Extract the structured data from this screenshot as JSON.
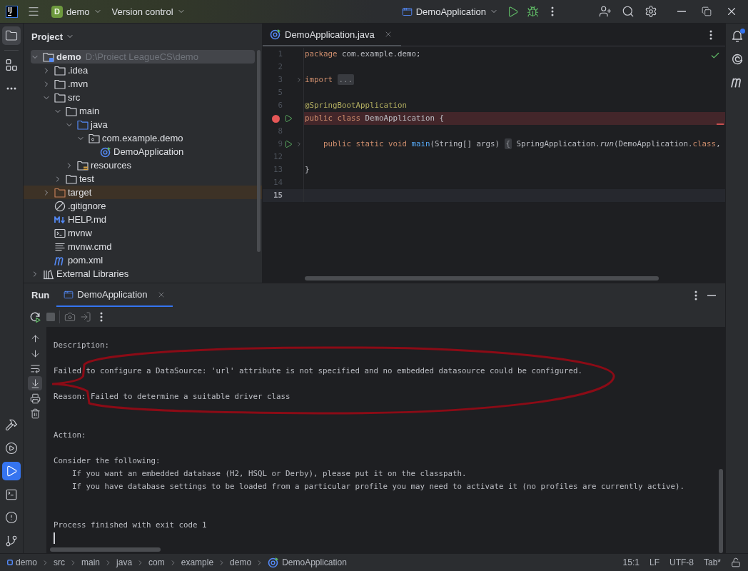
{
  "title_bar": {
    "logo": "IJ",
    "project_badge": "D",
    "project_name": "demo",
    "vcs_menu": "Version control",
    "run_configuration": "DemoApplication"
  },
  "left_toolbar": {
    "top": [
      {
        "kind": "project",
        "selected": true,
        "focused": false
      },
      {
        "kind": "structure",
        "selected": false,
        "focused": false
      },
      {
        "kind": "more",
        "selected": false,
        "focused": false
      }
    ],
    "bottom": [
      {
        "kind": "build",
        "selected": false,
        "focused": false
      },
      {
        "kind": "services",
        "selected": false,
        "focused": false
      },
      {
        "kind": "run",
        "selected": true,
        "focused": true
      },
      {
        "kind": "terminal",
        "selected": false,
        "focused": false
      },
      {
        "kind": "problems",
        "selected": false,
        "focused": false
      },
      {
        "kind": "git",
        "selected": false,
        "focused": false
      }
    ]
  },
  "project_panel": {
    "title": "Project",
    "tree": [
      {
        "label": "demo",
        "path": "D:\\Proiect LeagueCS\\demo",
        "kind": "module",
        "expanded": true,
        "selected": true,
        "children": [
          {
            "label": ".idea",
            "kind": "folder",
            "expanded": false,
            "selected": false
          },
          {
            "label": ".mvn",
            "kind": "folder",
            "expanded": false,
            "selected": false
          },
          {
            "label": "src",
            "kind": "folder",
            "expanded": true,
            "selected": false,
            "children": [
              {
                "label": "main",
                "kind": "folder",
                "expanded": true,
                "selected": false,
                "children": [
                  {
                    "label": "java",
                    "kind": "source-root",
                    "expanded": true,
                    "selected": false,
                    "children": [
                      {
                        "label": "com.example.demo",
                        "kind": "package",
                        "expanded": true,
                        "selected": false,
                        "children": [
                          {
                            "label": "DemoApplication",
                            "kind": "spring-class",
                            "selected": false
                          }
                        ]
                      }
                    ]
                  },
                  {
                    "label": "resources",
                    "kind": "resources-root",
                    "expanded": false,
                    "selected": false
                  }
                ]
              },
              {
                "label": "test",
                "kind": "folder",
                "expanded": false,
                "selected": false
              }
            ]
          },
          {
            "label": "target",
            "kind": "excluded-folder",
            "expanded": false,
            "selected": false
          },
          {
            "label": ".gitignore",
            "kind": "ignore-file",
            "selected": false
          },
          {
            "label": "HELP.md",
            "kind": "markdown-file",
            "selected": false
          },
          {
            "label": "mvnw",
            "kind": "script-file",
            "selected": false
          },
          {
            "label": "mvnw.cmd",
            "kind": "text-file",
            "selected": false
          },
          {
            "label": "pom.xml",
            "kind": "maven-file",
            "selected": false
          }
        ]
      },
      {
        "label": "External Libraries",
        "kind": "libraries",
        "expanded": false,
        "selected": false
      }
    ]
  },
  "editor": {
    "tabs": [
      {
        "label": "DemoApplication.java",
        "kind": "spring-class",
        "selected": true
      }
    ],
    "inspection_ok": true,
    "lines": [
      {
        "number": "1",
        "tokens": [
          {
            "text": "package",
            "kind": "keyword"
          },
          {
            "text": " com.example.demo;",
            "kind": "plain"
          }
        ],
        "breakpoint": false,
        "run_icon": false,
        "folded": false,
        "error": false,
        "current": false
      },
      {
        "number": "2",
        "breakpoint": false,
        "run_icon": false,
        "folded": false,
        "error": false,
        "current": false
      },
      {
        "number": "3",
        "tokens": [
          {
            "text": "import ",
            "kind": "keyword"
          },
          {
            "text": "...",
            "kind": "folded"
          }
        ],
        "breakpoint": false,
        "run_icon": false,
        "folded": true,
        "error": false,
        "current": false
      },
      {
        "number": "5",
        "breakpoint": false,
        "run_icon": false,
        "folded": false,
        "error": false,
        "current": false
      },
      {
        "number": "6",
        "tokens": [
          {
            "text": "@SpringBootApplication",
            "kind": "annotation"
          }
        ],
        "breakpoint": false,
        "run_icon": false,
        "folded": false,
        "error": false,
        "current": false
      },
      {
        "tokens": [
          {
            "text": "public class ",
            "kind": "keyword"
          },
          {
            "text": "DemoApplication {",
            "kind": "plain"
          }
        ],
        "breakpoint": true,
        "run_icon": true,
        "folded": false,
        "error": true,
        "current": false
      },
      {
        "number": "8",
        "breakpoint": false,
        "run_icon": false,
        "folded": false,
        "error": false,
        "current": false
      },
      {
        "number": "9",
        "tokens": [
          {
            "text": "    public static void ",
            "kind": "keyword"
          },
          {
            "text": "main",
            "kind": "method"
          },
          {
            "text": "(String[] args) ",
            "kind": "plain"
          },
          {
            "text": "{",
            "kind": "folded"
          },
          {
            "text": " SpringApplication.",
            "kind": "plain"
          },
          {
            "text": "run",
            "kind": "static-call"
          },
          {
            "text": "(DemoApplication.",
            "kind": "plain"
          },
          {
            "text": "class",
            "kind": "keyword"
          },
          {
            "text": ",",
            "kind": "plain"
          }
        ],
        "breakpoint": false,
        "run_icon": true,
        "folded": true,
        "error": false,
        "current": false
      },
      {
        "number": "12",
        "breakpoint": false,
        "run_icon": false,
        "folded": false,
        "error": false,
        "current": false
      },
      {
        "number": "13",
        "tokens": [
          {
            "text": "}",
            "kind": "plain"
          }
        ],
        "breakpoint": false,
        "run_icon": false,
        "folded": false,
        "error": false,
        "current": false
      },
      {
        "number": "14",
        "breakpoint": false,
        "run_icon": false,
        "folded": false,
        "error": false,
        "current": false
      },
      {
        "number": "15",
        "breakpoint": false,
        "run_icon": false,
        "folded": false,
        "error": false,
        "current": true
      }
    ]
  },
  "right_toolbar": [
    {
      "kind": "notifications",
      "badge": true
    },
    {
      "kind": "ai-assistant",
      "badge": false
    },
    {
      "kind": "maven",
      "badge": false
    }
  ],
  "run_panel": {
    "title": "Run",
    "tabs": [
      {
        "label": "DemoApplication",
        "selected": true
      }
    ],
    "toolbar_groups": [
      {
        "items": [
          {
            "kind": "rerun",
            "disabled": false
          },
          {
            "kind": "stop",
            "disabled": true
          }
        ]
      },
      {
        "items": [
          {
            "kind": "screenshot",
            "disabled": true
          },
          {
            "kind": "attach",
            "disabled": true
          },
          {
            "kind": "more",
            "disabled": false
          }
        ]
      }
    ],
    "side_tools": [
      {
        "kind": "scroll-up",
        "selected": false
      },
      {
        "kind": "scroll-down",
        "selected": false
      },
      {
        "kind": "soft-wrap",
        "selected": false
      },
      {
        "kind": "scroll-to-end",
        "selected": true
      },
      {
        "kind": "print",
        "selected": false
      },
      {
        "kind": "clear",
        "selected": false
      }
    ],
    "console": {
      "ellipse_annotation": true,
      "lines": [
        {
          "kind": "text",
          "text": "Description:"
        },
        {
          "kind": "blank"
        },
        {
          "kind": "text",
          "text": "Failed to configure a DataSource: 'url' attribute is not specified and no embedded datasource could be configured."
        },
        {
          "kind": "blank"
        },
        {
          "kind": "text",
          "text": "Reason: Failed to determine a suitable driver class"
        },
        {
          "kind": "blank"
        },
        {
          "kind": "blank"
        },
        {
          "kind": "text",
          "text": "Action:"
        },
        {
          "kind": "blank"
        },
        {
          "kind": "text",
          "text": "Consider the following:"
        },
        {
          "kind": "indented",
          "text": "If you want an embedded database (H2, HSQL or Derby), please put it on the classpath."
        },
        {
          "kind": "indented",
          "text": "If you have database settings to be loaded from a particular profile you may need to activate it (no profiles are currently active)."
        },
        {
          "kind": "blank"
        },
        {
          "kind": "blank"
        },
        {
          "kind": "text",
          "text": "Process finished with exit code 1"
        }
      ]
    }
  },
  "status_bar": {
    "breadcrumbs": [
      {
        "label": "demo",
        "kind": "module"
      },
      {
        "label": "src",
        "kind": "folder"
      },
      {
        "label": "main",
        "kind": "folder"
      },
      {
        "label": "java",
        "kind": "folder"
      },
      {
        "label": "com",
        "kind": "folder"
      },
      {
        "label": "example",
        "kind": "folder"
      },
      {
        "label": "demo",
        "kind": "folder"
      },
      {
        "label": "DemoApplication",
        "kind": "class"
      }
    ],
    "caret_position": "15:1",
    "line_separator": "LF",
    "encoding": "UTF-8",
    "indent": "Tab*",
    "read_only": false
  }
}
